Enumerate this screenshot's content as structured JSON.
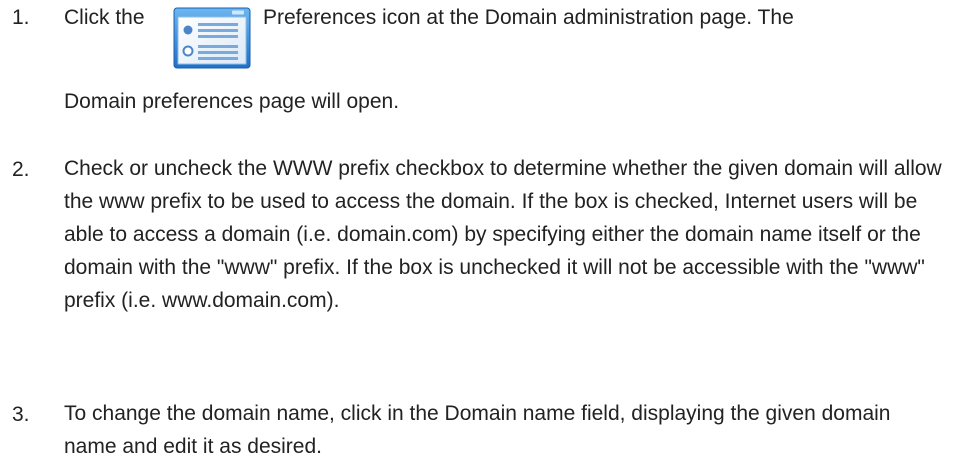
{
  "steps": [
    {
      "number": "1.",
      "text_before_icon": "Click the",
      "icon": "preferences-icon",
      "text_after_icon": "Preferences icon at the Domain administration page. The",
      "continuation": "Domain preferences page will open."
    },
    {
      "number": "2.",
      "text": "Check or uncheck the WWW prefix checkbox to determine whether the given domain will allow the www prefix to be used to access the domain. If the box is checked, Internet users will be able to access a domain (i.e. domain.com) by specifying either the domain name itself or the domain with the \"www\" prefix. If the box is unchecked it will not be accessible with the \"www\" prefix (i.e. www.domain.com)."
    },
    {
      "number": "3.",
      "text": "To change the domain name, click in the Domain name field, displaying the given domain name and edit it as desired."
    }
  ]
}
